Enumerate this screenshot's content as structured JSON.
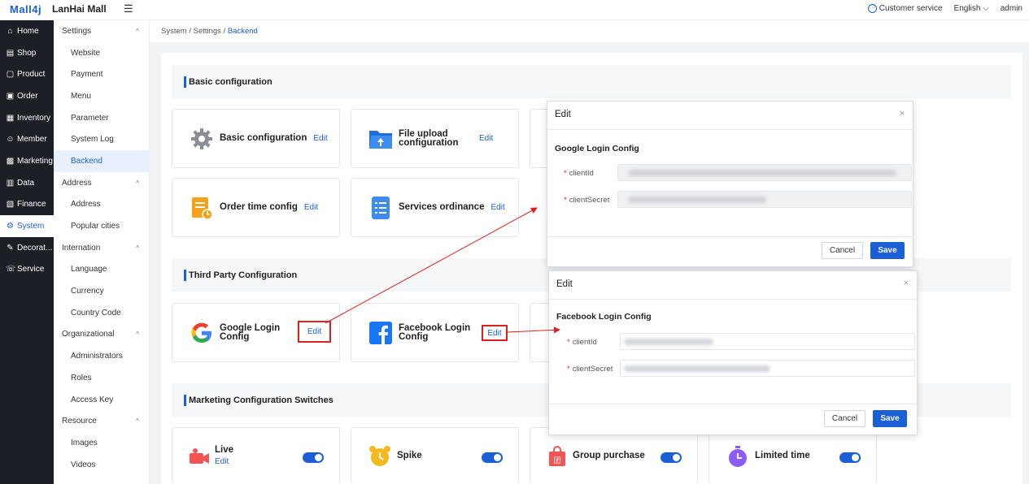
{
  "header": {
    "logo": "Mall4j",
    "mall_name": "LanHai Mall",
    "menu_toggle": "☰",
    "customer_service": "Customer service",
    "language": "English",
    "user": "admin"
  },
  "nav_primary": [
    {
      "icon": "⌂",
      "label": "Home"
    },
    {
      "icon": "▤",
      "label": "Shop"
    },
    {
      "icon": "▢",
      "label": "Product"
    },
    {
      "icon": "▣",
      "label": "Order"
    },
    {
      "icon": "▦",
      "label": "Inventory"
    },
    {
      "icon": "☺",
      "label": "Member"
    },
    {
      "icon": "▩",
      "label": "Marketing"
    },
    {
      "icon": "▥",
      "label": "Data"
    },
    {
      "icon": "▧",
      "label": "Finance"
    },
    {
      "icon": "⚙",
      "label": "System"
    },
    {
      "icon": "✎",
      "label": "Decorat..."
    },
    {
      "icon": "☏",
      "label": "Service"
    }
  ],
  "nav_secondary": [
    {
      "label": "Settings",
      "type": "group"
    },
    {
      "label": "Website",
      "type": "sub"
    },
    {
      "label": "Payment",
      "type": "sub"
    },
    {
      "label": "Menu",
      "type": "sub"
    },
    {
      "label": "Parameter",
      "type": "sub"
    },
    {
      "label": "System Log",
      "type": "sub"
    },
    {
      "label": "Backend",
      "type": "sub"
    },
    {
      "label": "Address",
      "type": "group"
    },
    {
      "label": "Address",
      "type": "sub"
    },
    {
      "label": "Popular cities",
      "type": "sub"
    },
    {
      "label": "Internation",
      "type": "group"
    },
    {
      "label": "Language",
      "type": "sub"
    },
    {
      "label": "Currency",
      "type": "sub"
    },
    {
      "label": "Country Code",
      "type": "sub"
    },
    {
      "label": "Organizational",
      "type": "group"
    },
    {
      "label": "Administrators",
      "type": "sub"
    },
    {
      "label": "Roles",
      "type": "sub"
    },
    {
      "label": "Access Key",
      "type": "sub"
    },
    {
      "label": "Resource",
      "type": "group"
    },
    {
      "label": "Images",
      "type": "sub"
    },
    {
      "label": "Videos",
      "type": "sub"
    }
  ],
  "breadcrumb": {
    "a": "System",
    "sep": "/",
    "b": "Settings",
    "c": "Backend"
  },
  "sections": {
    "basic": "Basic configuration",
    "third": "Third Party Configuration",
    "marketing": "Marketing Configuration Switches"
  },
  "cards": {
    "basic_config": {
      "title": "Basic configuration",
      "edit": "Edit"
    },
    "file_upload": {
      "title": "File upload configuration",
      "edit": "Edit"
    },
    "order_time": {
      "title": "Order time config",
      "edit": "Edit"
    },
    "services": {
      "title": "Services ordinance",
      "edit": "Edit"
    },
    "google": {
      "title": "Google Login Config",
      "edit": "Edit"
    },
    "facebook": {
      "title": "Facebook Login Config",
      "edit": "Edit"
    },
    "live": {
      "title": "Live",
      "edit": "Edit"
    },
    "spike": {
      "title": "Spike"
    },
    "group": {
      "title": "Group purchase"
    },
    "limited": {
      "title": "Limited time"
    }
  },
  "modal_google": {
    "title": "Edit",
    "close": "×",
    "subtitle": "Google Login Config",
    "label1": "clientId",
    "label2": "clientSecret",
    "cancel": "Cancel",
    "save": "Save"
  },
  "modal_facebook": {
    "title": "Edit",
    "close": "×",
    "subtitle": "Facebook Login Config",
    "label1": "clientId",
    "label2": "clientSecret",
    "cancel": "Cancel",
    "save": "Save"
  },
  "required_mark": "*",
  "colors": {
    "accent": "#1a5fd6",
    "annotation": "#e02020",
    "sidebar": "#1c1f26"
  }
}
